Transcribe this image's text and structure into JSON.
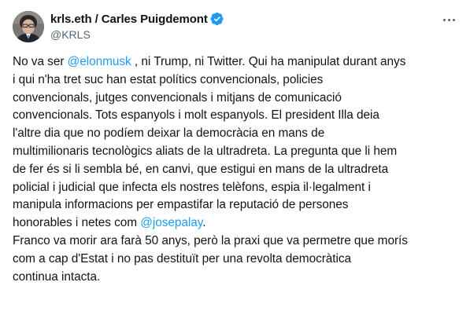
{
  "author": {
    "display_name": "krls.eth / Carles Puigdemont",
    "handle": "@KRLS",
    "verified": true
  },
  "icons": {
    "verified": "verified-badge-icon",
    "more": "more-options-icon"
  },
  "colors": {
    "text": "#0f1419",
    "secondary": "#536471",
    "link": "#1d9bf0"
  },
  "tweet": {
    "l1_a": "No va ser ",
    "mention_1": "@elonmusk",
    "l1_b": " , ni Trump, ni Twitter. Qui ha manipulat durant anys",
    "l2": "i qui n'ha tret suc han estat polítics convencionals, policies",
    "l3": "convencionals, jutges convencionals i mitjans de comunicació",
    "l4": "convencionals. Tots espanyols i molt espanyols. El president Illa deia",
    "l5": "l'altre dia que no podíem deixar la democràcia en mans de",
    "l6": "multimilionaris tecnològics aliats de la ultradreta. La pregunta que li hem",
    "l7": "de fer és si li sembla bé, en canvi, que estigui en mans de la ultradreta",
    "l8": "policial i judicial que infecta els nostres telèfons, espia il·legalment i",
    "l9": "manipula informacions per empastifar la reputació de persones",
    "l10_a": "honorables i netes com ",
    "mention_2": "@josepalay",
    "l10_b": ".",
    "l11": "Franco va morir ara farà 50 anys, però la praxi que va permetre que morís",
    "l12": "com a cap d'Estat i no pas destituït per una revolta democràtica",
    "l13": "continua intacta."
  }
}
